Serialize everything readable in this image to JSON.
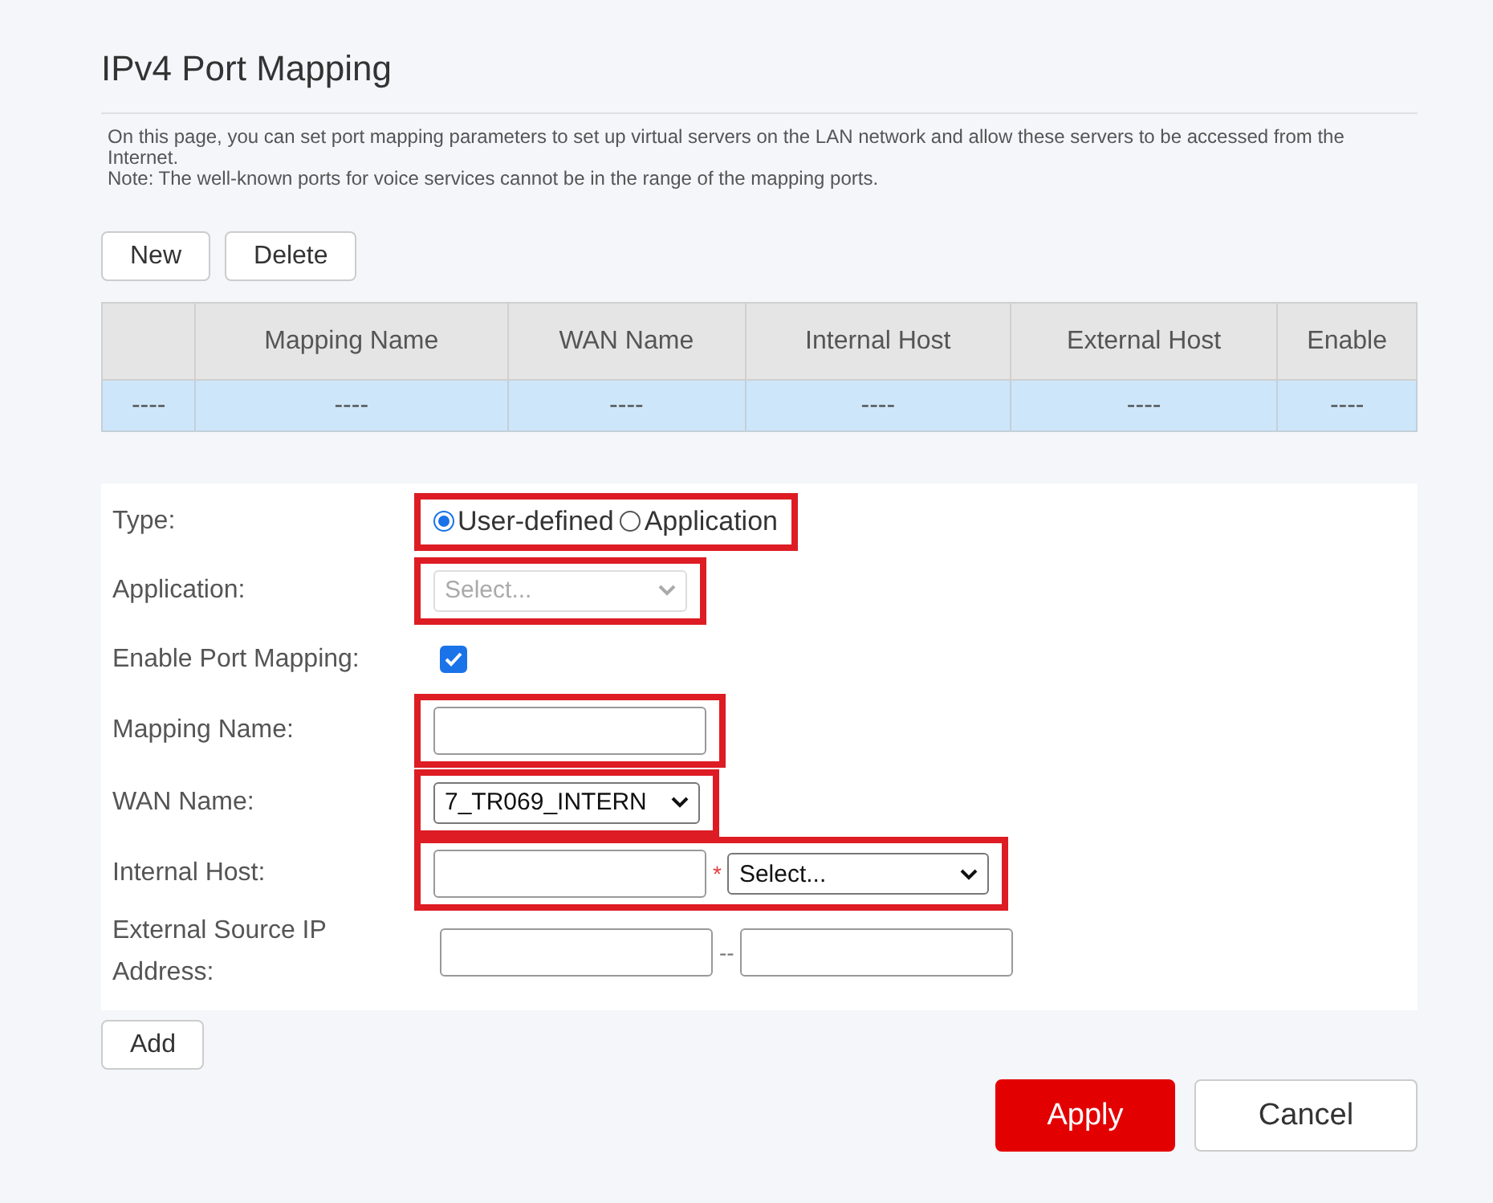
{
  "title": "IPv4 Port Mapping",
  "description": [
    "On this page, you can set port mapping parameters to set up virtual servers on the LAN network and allow these servers to be accessed from the Internet.",
    "Note: The well-known ports for voice services cannot be in the range of the mapping ports."
  ],
  "toolbar": [
    "New",
    "Delete"
  ],
  "table": {
    "columns": [
      "",
      "Mapping Name",
      "WAN Name",
      "Internal Host",
      "External Host",
      "Enable"
    ],
    "rows": [
      {
        "cells": [
          "----",
          "----",
          "----",
          "----",
          "----",
          "----"
        ],
        "selected": true
      }
    ]
  },
  "form": [
    {
      "kind": "radio",
      "label": "Type:",
      "highlighted": true,
      "options": [
        {
          "label": "User-defined",
          "selected": true
        },
        {
          "label": "Application",
          "selected": false
        }
      ]
    },
    {
      "kind": "select",
      "label": "Application:",
      "highlighted": true,
      "value": "Select...",
      "disabled": true
    },
    {
      "kind": "checkbox",
      "label": "Enable Port Mapping:",
      "highlighted": false,
      "checked": true
    },
    {
      "kind": "text",
      "label": "Mapping Name:",
      "highlighted": true
    },
    {
      "kind": "select",
      "label": "WAN Name:",
      "highlighted": true,
      "value": "7_TR069_INTERN",
      "disabled": false
    },
    {
      "kind": "host",
      "label": "Internal Host:",
      "highlighted": true,
      "required": "*",
      "value": "Select..."
    },
    {
      "kind": "range",
      "label": "External Source IP Address:",
      "highlighted": false,
      "separator": "--"
    }
  ],
  "add_button": "Add",
  "apply_button": "Apply",
  "cancel_button": "Cancel"
}
